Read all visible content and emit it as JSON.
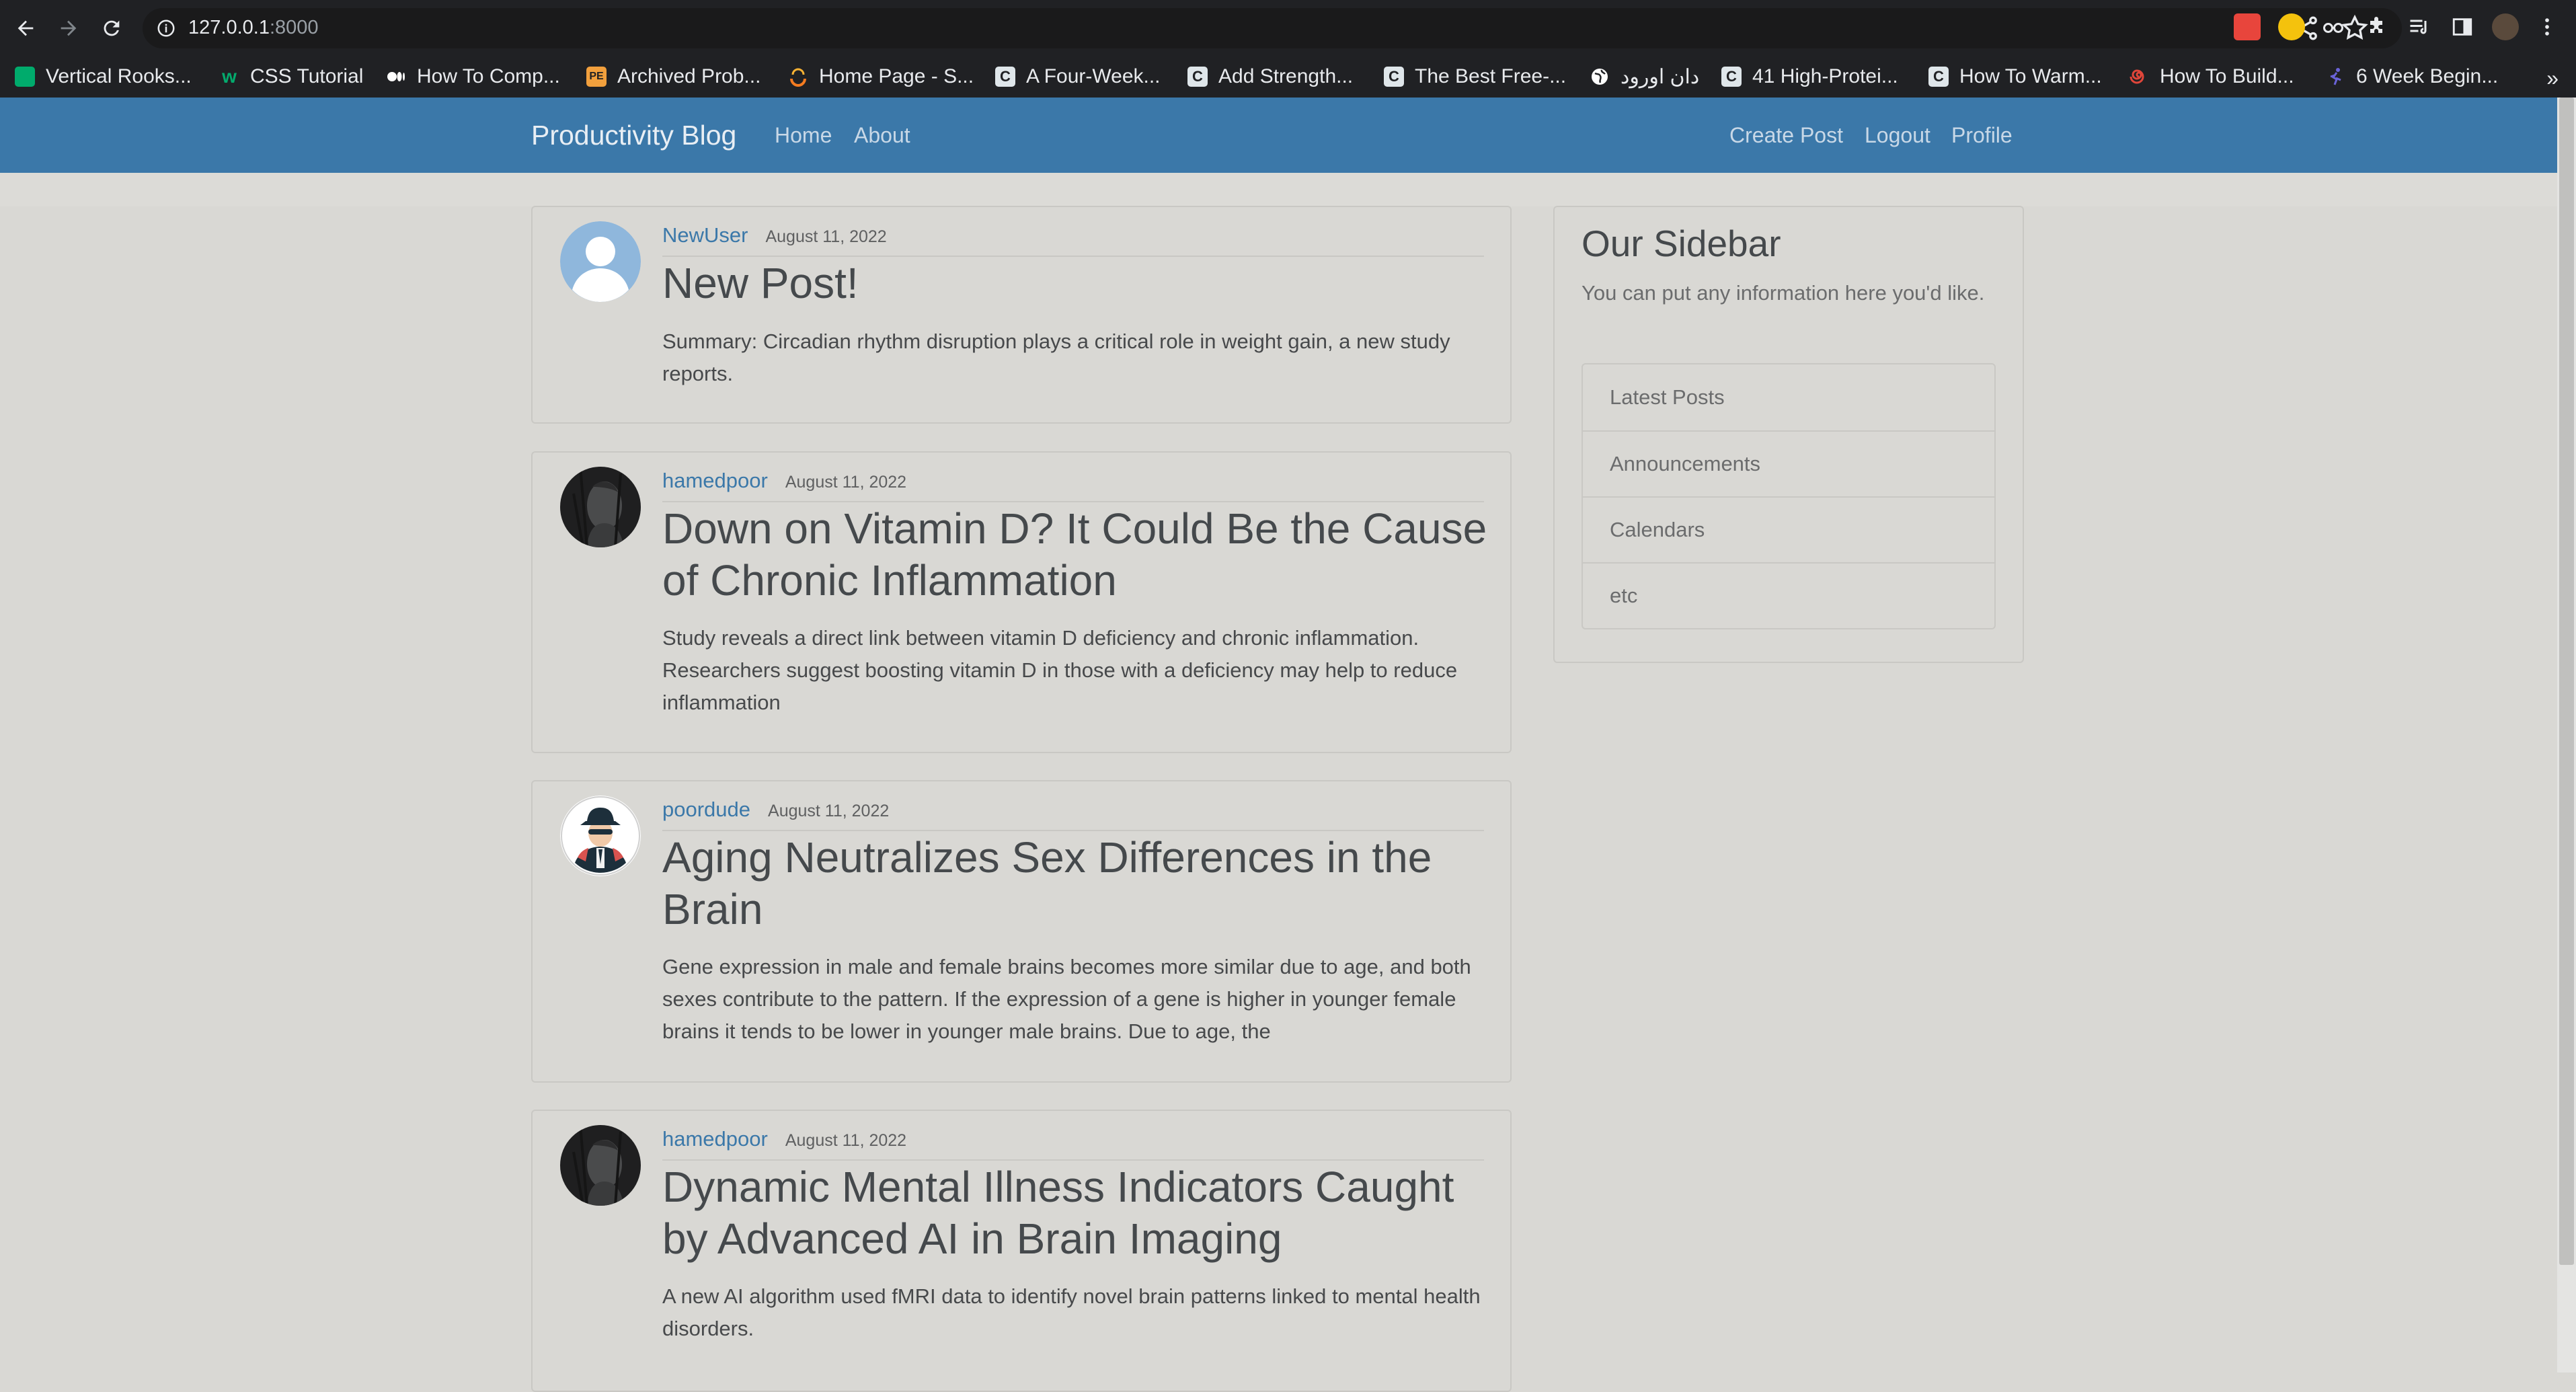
{
  "browser": {
    "url_host": "127.0.0.1",
    "url_port": ":8000",
    "bookmarks": [
      {
        "label": "Vertical Rooks...",
        "icon": "medium-icon",
        "color": "#00ab6c"
      },
      {
        "label": "CSS Tutorial",
        "icon": "w3schools-icon",
        "color": "#04aa6d"
      },
      {
        "label": "How To Comp...",
        "icon": "medium-icon",
        "color": "#ffffff"
      },
      {
        "label": "Archived Prob...",
        "icon": "projecteuler-icon",
        "color": "#f2a03d"
      },
      {
        "label": "Home Page - S...",
        "icon": "sololearn-icon",
        "color": "#f47b20"
      },
      {
        "label": "A Four-Week...",
        "icon": "c-letter-icon",
        "color": "#dfe6ea"
      },
      {
        "label": "Add Strength...",
        "icon": "c-letter-icon",
        "color": "#dfe6ea"
      },
      {
        "label": "The Best Free-...",
        "icon": "c-letter-icon",
        "color": "#dfe6ea"
      },
      {
        "label": "دان اورود",
        "icon": "globe-icon",
        "color": "#ffffff"
      },
      {
        "label": "41 High-Protei...",
        "icon": "c-letter-icon",
        "color": "#dfe6ea"
      },
      {
        "label": "How To Warm...",
        "icon": "c-letter-icon",
        "color": "#dfe6ea"
      },
      {
        "label": "How To Build...",
        "icon": "spiral-icon",
        "color": "#e0463a"
      },
      {
        "label": "6 Week Begin...",
        "icon": "runner-icon",
        "color": "#6a63d8"
      }
    ]
  },
  "navbar": {
    "brand": "Productivity Blog",
    "left_links": [
      "Home",
      "About"
    ],
    "right_links": [
      "Create Post",
      "Logout",
      "Profile"
    ]
  },
  "posts": [
    {
      "author": "NewUser",
      "date": "August 11, 2022",
      "title": "New Post!",
      "summary": "Summary: Circadian rhythm disruption plays a critical role in weight gain, a new study reports.",
      "avatar": "default-avatar-icon"
    },
    {
      "author": "hamedpoor",
      "date": "August 11, 2022",
      "title": "Down on Vitamin D? It Could Be the Cause of Chronic Inflammation",
      "summary": "Study reveals a direct link between vitamin D deficiency and chronic inflammation. Researchers suggest boosting vitamin D in those with a deficiency may help to reduce inflammation",
      "avatar": "dark-portrait-avatar"
    },
    {
      "author": "poordude",
      "date": "August 11, 2022",
      "title": "Aging Neutralizes Sex Differences in the Brain",
      "summary": "Gene expression in male and female brains becomes more similar due to age, and both sexes contribute to the pattern. If the expression of a gene is higher in younger female brains it tends to be lower in younger male brains. Due to age, the",
      "avatar": "spy-hat-avatar"
    },
    {
      "author": "hamedpoor",
      "date": "August 11, 2022",
      "title": "Dynamic Mental Illness Indicators Caught by Advanced AI in Brain Imaging",
      "summary": "A new AI algorithm used fMRI data to identify novel brain patterns linked to mental health disorders.",
      "avatar": "dark-portrait-avatar"
    }
  ],
  "sidebar": {
    "title": "Our Sidebar",
    "text": "You can put any information here you'd like.",
    "items": [
      "Latest Posts",
      "Announcements",
      "Calendars",
      "etc"
    ]
  },
  "colors": {
    "navbar": "#3b78a9",
    "page_bg": "#d9d8d4",
    "link": "#3b78a9"
  }
}
